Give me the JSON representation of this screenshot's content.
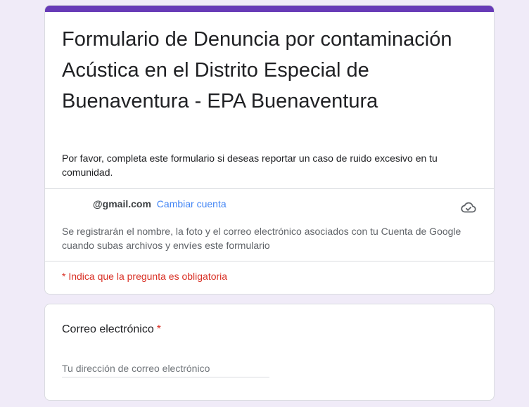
{
  "colors": {
    "accent": "#673ab7",
    "link": "#4285f4",
    "required": "#d93025",
    "background": "#f0ebf8"
  },
  "form": {
    "title": "Formulario de Denuncia por contaminación Acústica en el Distrito Especial de Buenaventura - EPA Buenaventura",
    "description": "Por favor, completa este formulario si deseas reportar un caso de ruido excesivo en tu comunidad."
  },
  "account": {
    "email": "@gmail.com",
    "switch_label": "Cambiar cuenta",
    "cloud_icon": "cloud-check-icon",
    "notice": "Se registrarán el nombre, la foto y el correo electrónico asociados con tu Cuenta de Google cuando subas archivos y envíes este formulario"
  },
  "required_note": "* Indica que la pregunta es obligatoria",
  "question": {
    "label": "Correo electrónico",
    "required_mark": "*",
    "placeholder": "Tu dirección de correo electrónico"
  }
}
